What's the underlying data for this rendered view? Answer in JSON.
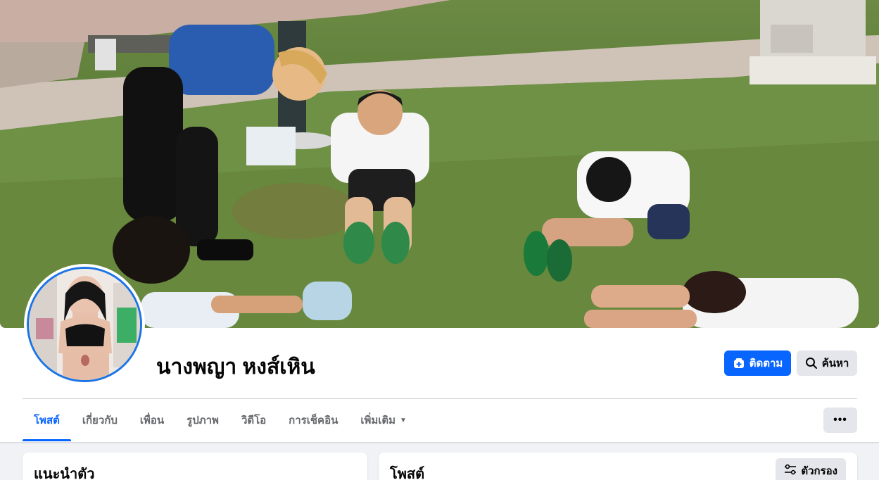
{
  "profile": {
    "name": "นางพญา หงส์เหิน"
  },
  "actions": {
    "follow_label": "ติดตาม",
    "follow_icon": "follow-plus-icon",
    "search_label": "ค้นหา",
    "search_icon": "search-icon",
    "more_label": "•••"
  },
  "tabs": [
    {
      "label": "โพสต์",
      "active": true
    },
    {
      "label": "เกี่ยวกับ",
      "active": false
    },
    {
      "label": "เพื่อน",
      "active": false
    },
    {
      "label": "รูปภาพ",
      "active": false
    },
    {
      "label": "วิดีโอ",
      "active": false
    },
    {
      "label": "การเช็คอิน",
      "active": false
    },
    {
      "label": "เพิ่มเติม",
      "active": false
    }
  ],
  "intro": {
    "title": "แนะนำตัว"
  },
  "posts": {
    "title": "โพสต์",
    "filter_label": "ตัวกรอง",
    "filter_icon": "filter-sliders-icon"
  },
  "colors": {
    "accent": "#0866ff",
    "background": "#f0f2f5",
    "button_gray": "#e4e6eb",
    "avatar_ring": "#1b74e4"
  }
}
